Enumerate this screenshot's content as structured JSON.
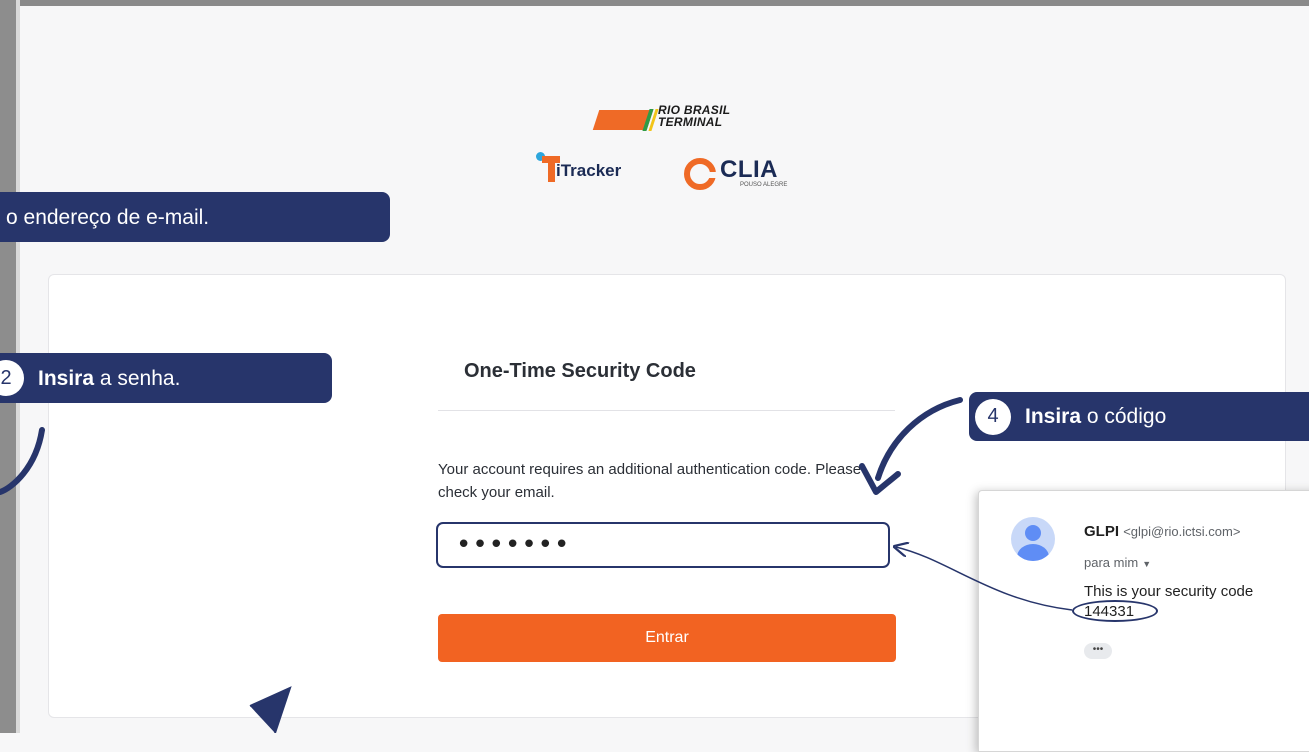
{
  "colors": {
    "accent_navy": "#27356b",
    "button_orange": "#f26322",
    "logo_orange": "#ef6a26"
  },
  "logos": {
    "rio_brasil_line1": "RIO BRASIL",
    "rio_brasil_line2": "TERMINAL",
    "itracker": "iTracker",
    "clia": "CLIA",
    "clia_sub": "POUSO ALEGRE"
  },
  "callouts": {
    "step1_text": "o endereço de e-mail.",
    "step2_number": "2",
    "step2_bold": "Insira",
    "step2_text": " a senha.",
    "step4_number": "4",
    "step4_bold": "Insira",
    "step4_text": " o código"
  },
  "form": {
    "title": "One-Time Security Code",
    "message": "Your account requires an additional authentication code. Please check your email.",
    "code_value": "•••••••",
    "submit_label": "Entrar"
  },
  "email": {
    "sender_name": "GLPI",
    "sender_address": "<glpi@rio.ictsi.com>",
    "recipient": "para mim",
    "body": "This is your security code",
    "code": "144331",
    "more": "•••"
  }
}
